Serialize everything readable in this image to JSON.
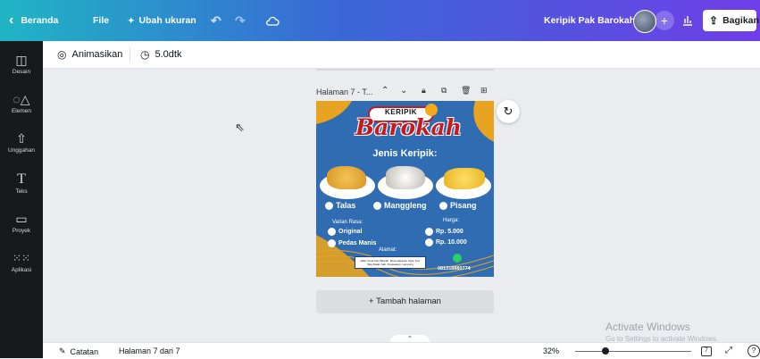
{
  "topbar": {
    "home_label": "Beranda",
    "file_label": "File",
    "resize_label": "Ubah ukuran",
    "project_name": "Keripik Pak Barokah",
    "share_label": "Bagikan"
  },
  "sidebar": {
    "items": [
      {
        "label": "Desain",
        "icon": "layout-icon"
      },
      {
        "label": "Elemen",
        "icon": "shapes-icon"
      },
      {
        "label": "Unggahan",
        "icon": "cloud-upload-icon"
      },
      {
        "label": "Teks",
        "icon": "text-icon"
      },
      {
        "label": "Proyek",
        "icon": "folder-icon"
      },
      {
        "label": "Aplikasi",
        "icon": "apps-grid-icon"
      }
    ]
  },
  "toolbar": {
    "animate_label": "Animasikan",
    "duration": "5.0dtk"
  },
  "page": {
    "title": "Halaman 7 - T...",
    "add_page_label": "+ Tambah halaman"
  },
  "design": {
    "badge": "KERIPIK",
    "brand": "Barokah",
    "subtitle": "Jenis Keripik:",
    "types": [
      "Talas",
      "Manggleng",
      "Pisang"
    ],
    "variant_header": "Varian Rasa:",
    "variants": [
      "Original",
      "Pedas Manis"
    ],
    "price_header": "Harga:",
    "prices": [
      "Rp. 5.000",
      "Rp. 10.000"
    ],
    "address_label": "Alamat:",
    "address_text": "Jalan Umar Dan Basrah, Desa Harapan Jaya, Kec. Way Ratai, Kab. Pesawaran, Lampung",
    "phone": "081318880774"
  },
  "watermark": {
    "title": "Activate Windows",
    "subtitle": "Go to Settings to activate Windows."
  },
  "bottombar": {
    "notes_label": "Catatan",
    "page_indicator": "Halaman 7 dari 7",
    "zoom": "32%",
    "zoom_fraction": 0.32,
    "page_count_badge": "7"
  },
  "colors": {
    "accent_blue": "#2f6cb1",
    "brand_red": "#c41a21",
    "gold": "#e8a320"
  }
}
